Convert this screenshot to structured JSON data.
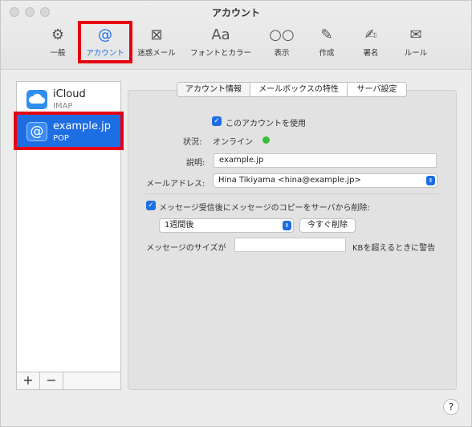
{
  "window": {
    "title": "アカウント"
  },
  "toolbar": {
    "items": [
      {
        "label": "一般",
        "icon": "gear-icon",
        "glyph": "⚙"
      },
      {
        "label": "アカウント",
        "icon": "at-icon",
        "glyph": "@"
      },
      {
        "label": "迷惑メール",
        "icon": "junk-trash-icon",
        "glyph": "⊠"
      },
      {
        "label": "フォントとカラー",
        "icon": "font-icon",
        "glyph": "Aa"
      },
      {
        "label": "表示",
        "icon": "glasses-icon",
        "glyph": "○○"
      },
      {
        "label": "作成",
        "icon": "compose-icon",
        "glyph": "✎"
      },
      {
        "label": "署名",
        "icon": "signature-icon",
        "glyph": "✍"
      },
      {
        "label": "ルール",
        "icon": "rules-icon",
        "glyph": "✉"
      }
    ],
    "active": "アカウント"
  },
  "sidebar": {
    "accounts": [
      {
        "name": "iCloud",
        "type": "IMAP",
        "icon": "cloud-icon"
      },
      {
        "name": "example.jp",
        "type": "POP",
        "icon": "at-icon"
      }
    ],
    "add_label": "+",
    "remove_label": "−"
  },
  "tabs": [
    {
      "label": "アカウント情報"
    },
    {
      "label": "メールボックスの特性"
    },
    {
      "label": "サーバ設定"
    }
  ],
  "form": {
    "enable_label": "このアカウントを使用",
    "status_label": "状況:",
    "status_value": "オンライン",
    "description_label": "説明:",
    "description_value": "example.jp",
    "email_label": "メールアドレス:",
    "email_value": "Hina Tikiyama <hina@example.jp>",
    "remove_copy_label": "メッセージ受信後にメッセージのコピーをサーバから削除:",
    "remove_after_value": "1週間後",
    "remove_now_label": "今すぐ削除",
    "size_label": "メッセージのサイズが",
    "size_value": "",
    "size_suffix": "KBを超えるときに警告"
  },
  "help_label": "?",
  "colors": {
    "accent": "#1d6de3",
    "highlight": "#e60012",
    "online": "#3bbd3b"
  }
}
